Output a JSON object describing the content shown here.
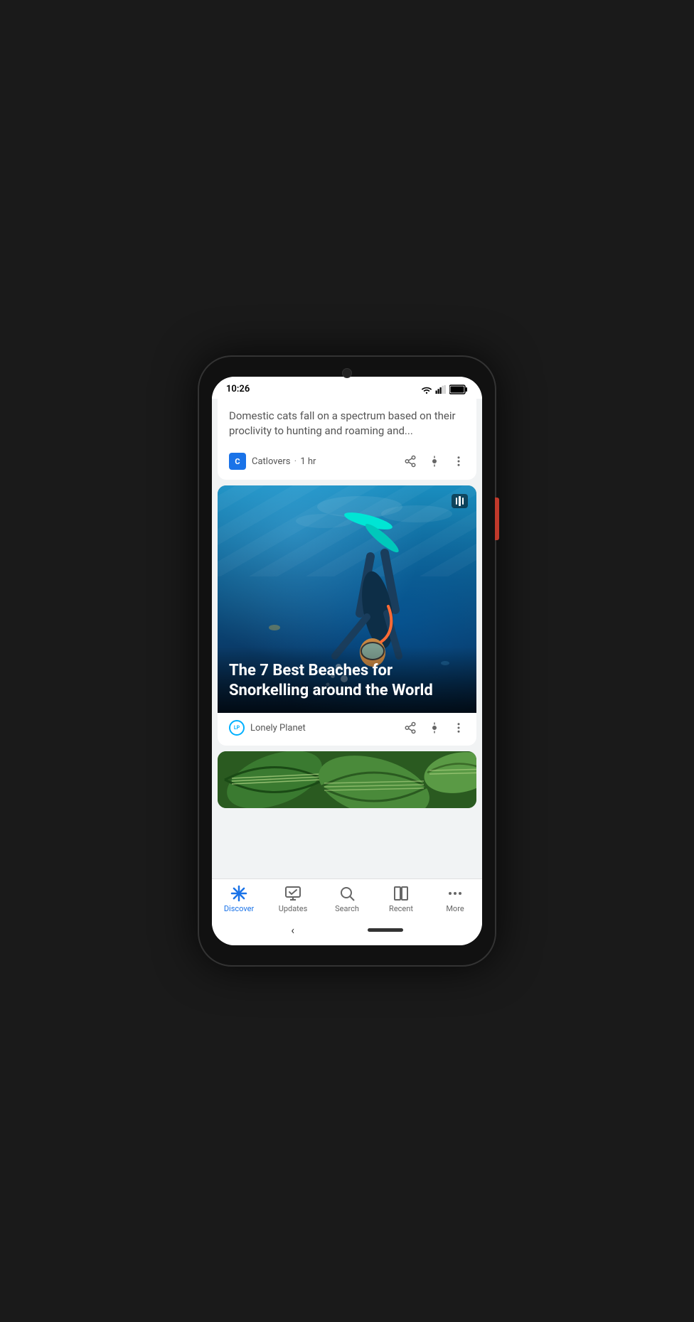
{
  "status_bar": {
    "time": "10:26"
  },
  "cards": [
    {
      "id": "catlovers-card",
      "description": "Domestic cats fall on a spectrum based on their proclivity to hunting and roaming and...",
      "source": "Catlovers",
      "time_ago": "1 hr",
      "logo_text": "C"
    },
    {
      "id": "snorkelling-card",
      "title": "The 7 Best Beaches for Snorkelling around the World",
      "source": "Lonely Planet",
      "logo_text": "LP",
      "image_alt": "Snorkeler diving underwater"
    }
  ],
  "bottom_nav": {
    "items": [
      {
        "id": "discover",
        "label": "Discover",
        "active": true
      },
      {
        "id": "updates",
        "label": "Updates",
        "active": false
      },
      {
        "id": "search",
        "label": "Search",
        "active": false
      },
      {
        "id": "recent",
        "label": "Recent",
        "active": false
      },
      {
        "id": "more",
        "label": "More",
        "active": false
      }
    ]
  },
  "actions": {
    "share": "⬆",
    "interest": "●",
    "more": "⋮"
  }
}
